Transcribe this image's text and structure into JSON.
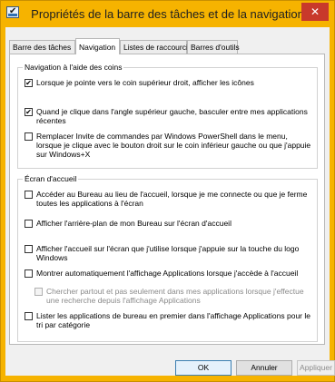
{
  "window": {
    "title": "Propriétés de la barre des tâches et de la navigation",
    "close_glyph": "✕"
  },
  "tabs": [
    {
      "label": "Barre des tâches",
      "active": false
    },
    {
      "label": "Navigation",
      "active": true
    },
    {
      "label": "Listes de raccourcis",
      "active": false
    },
    {
      "label": "Barres d'outils",
      "active": false
    }
  ],
  "groups": {
    "corners": {
      "label": "Navigation à l'aide des coins",
      "options": [
        {
          "label": "Lorsque je pointe vers le coin supérieur droit, afficher les icônes",
          "checked": true,
          "enabled": true
        },
        {
          "label": "Quand je clique dans l'angle supérieur gauche, basculer entre mes applications récentes",
          "checked": true,
          "enabled": true
        },
        {
          "label": "Remplacer Invite de commandes par Windows PowerShell dans le menu, lorsque je clique avec le bouton droit sur le coin inférieur gauche ou que j'appuie sur Windows+X",
          "checked": false,
          "enabled": true
        }
      ]
    },
    "start": {
      "label": "Écran d'accueil",
      "options": [
        {
          "label": "Accéder au Bureau au lieu de l'accueil, lorsque je me connecte ou que je ferme toutes les applications à l'écran",
          "checked": false,
          "enabled": true
        },
        {
          "label": "Afficher l'arrière-plan de mon Bureau sur l'écran d'accueil",
          "checked": false,
          "enabled": true
        },
        {
          "label": "Afficher l'accueil sur l'écran que j'utilise lorsque j'appuie sur la touche du logo Windows",
          "checked": false,
          "enabled": true
        },
        {
          "label": "Montrer automatiquement l'affichage Applications lorsque j'accède à l'accueil",
          "checked": false,
          "enabled": true
        },
        {
          "label": "Chercher partout et pas seulement dans mes applications lorsque j'effectue une recherche depuis l'affichage Applications",
          "checked": false,
          "enabled": false
        },
        {
          "label": "Lister les applications de bureau en premier dans l'affichage Applications pour le tri par catégorie",
          "checked": false,
          "enabled": true
        }
      ]
    }
  },
  "buttons": {
    "ok": "OK",
    "cancel": "Annuler",
    "apply": "Appliquer"
  },
  "colors": {
    "titlebar": "#f6b300",
    "close": "#c8392b"
  },
  "checkmark_glyph": "✔"
}
